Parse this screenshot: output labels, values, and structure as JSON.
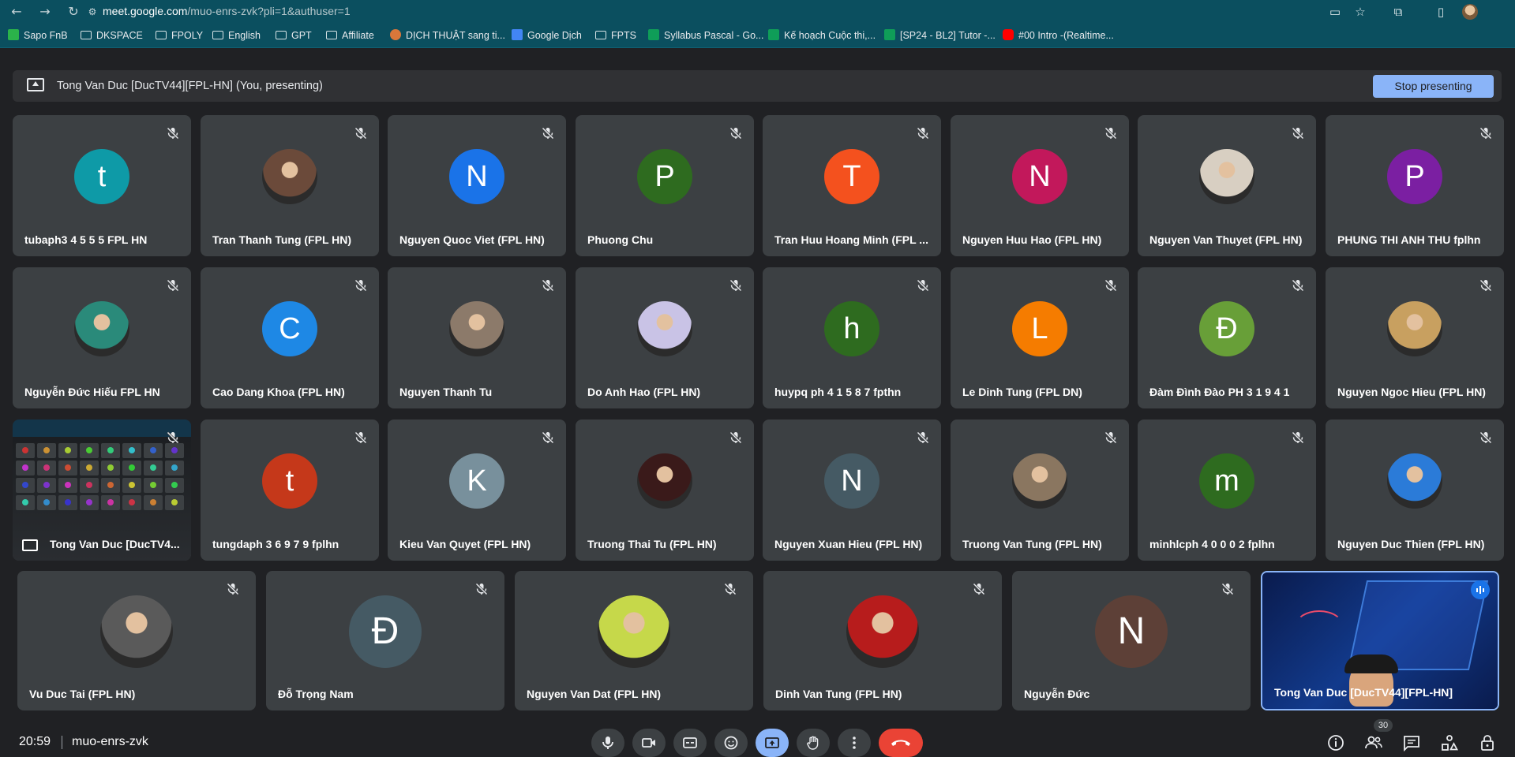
{
  "browser": {
    "url_host": "meet.google.com",
    "url_path": "/muo-enrs-zvk?pli=1&authuser=1",
    "bookmarks": [
      {
        "label": "Sapo FnB",
        "icon": "sapo-icon"
      },
      {
        "label": "DKSPACE",
        "icon": "folder-icon"
      },
      {
        "label": "FPOLY",
        "icon": "folder-icon"
      },
      {
        "label": "English",
        "icon": "folder-icon"
      },
      {
        "label": "GPT",
        "icon": "folder-icon"
      },
      {
        "label": "Affiliate",
        "icon": "folder-icon"
      },
      {
        "label": "DỊCH THUẬT sang ti...",
        "icon": "translate-site-icon"
      },
      {
        "label": "Google Dịch",
        "icon": "google-translate-icon"
      },
      {
        "label": "FPTS",
        "icon": "folder-icon"
      },
      {
        "label": "Syllabus Pascal - Go...",
        "icon": "google-sheets-icon"
      },
      {
        "label": "Kế hoạch Cuộc thi,...",
        "icon": "google-sheets-icon"
      },
      {
        "label": "[SP24 - BL2] Tutor -...",
        "icon": "google-sheets-icon"
      },
      {
        "label": "#00 Intro -(Realtime...",
        "icon": "youtube-icon"
      }
    ]
  },
  "presenting_bar": {
    "text": "Tong Van Duc [DucTV44][FPL-HN] (You, presenting)",
    "stop_label": "Stop presenting"
  },
  "participants": [
    {
      "name": "tubaph3 4 5 5 5 FPL HN",
      "letter": "t",
      "color": "#0e9aa7"
    },
    {
      "name": "Tran Thanh Tung (FPL HN)",
      "letter": "",
      "color": "#6b4a3a"
    },
    {
      "name": "Nguyen Quoc Viet (FPL HN)",
      "letter": "N",
      "color": "#1a73e8"
    },
    {
      "name": "Phuong Chu",
      "letter": "P",
      "color": "#2e6b1f"
    },
    {
      "name": "Tran Huu Hoang Minh (FPL ...",
      "letter": "T",
      "color": "#f4511e"
    },
    {
      "name": "Nguyen Huu Hao (FPL HN)",
      "letter": "N",
      "color": "#c2185b"
    },
    {
      "name": "Nguyen Van Thuyet (FPL HN)",
      "letter": "",
      "color": "#d8cfc2"
    },
    {
      "name": "PHUNG THI ANH THU fplhn",
      "letter": "P",
      "color": "#7b1fa2"
    },
    {
      "name": "Nguyễn Đức Hiếu FPL HN",
      "letter": "",
      "color": "#2a8a7a"
    },
    {
      "name": "Cao Dang Khoa (FPL HN)",
      "letter": "C",
      "color": "#1e88e5"
    },
    {
      "name": "Nguyen Thanh Tu",
      "letter": "",
      "color": "#8c7a6a"
    },
    {
      "name": "Do Anh Hao (FPL HN)",
      "letter": "",
      "color": "#c9c3e6"
    },
    {
      "name": "huypq ph 4 1 5 8 7 fpthn",
      "letter": "h",
      "color": "#2e6b1f"
    },
    {
      "name": "Le Dinh Tung (FPL DN)",
      "letter": "L",
      "color": "#f57c00"
    },
    {
      "name": "Đàm Đình Đào PH 3 1 9 4 1",
      "letter": "Đ",
      "color": "#689f38"
    },
    {
      "name": "Nguyen Ngoc Hieu (FPL HN)",
      "letter": "",
      "color": "#c8a060"
    },
    {
      "name": "Tong Van Duc [DucTV4...",
      "letter": "",
      "color": "#202124"
    },
    {
      "name": "tungdaph 3 6 9 7 9 fplhn",
      "letter": "t",
      "color": "#c5381a"
    },
    {
      "name": "Kieu Van Quyet (FPL HN)",
      "letter": "K",
      "color": "#78909c"
    },
    {
      "name": "Truong Thai Tu (FPL HN)",
      "letter": "",
      "color": "#3a1a1a"
    },
    {
      "name": "Nguyen Xuan Hieu (FPL HN)",
      "letter": "N",
      "color": "#455a64"
    },
    {
      "name": "Truong Van Tung (FPL HN)",
      "letter": "",
      "color": "#8a7660"
    },
    {
      "name": "minhlcph 4 0 0 0 2 fplhn",
      "letter": "m",
      "color": "#2e6b1f"
    },
    {
      "name": "Nguyen Duc Thien (FPL HN)",
      "letter": "",
      "color": "#2b7bd8"
    },
    {
      "name": "Vu Duc Tai (FPL HN)",
      "letter": "",
      "color": "#5a5a5a"
    },
    {
      "name": "Đỗ Trọng Nam",
      "letter": "Đ",
      "color": "#455a64"
    },
    {
      "name": "Nguyen Van Dat (FPL HN)",
      "letter": "",
      "color": "#c6d84a"
    },
    {
      "name": "Dinh Van Tung (FPL HN)",
      "letter": "",
      "color": "#b71c1c"
    },
    {
      "name": "Nguyễn Đức",
      "letter": "N",
      "color": "#5d4037"
    },
    {
      "name": "Tong Van Duc [DucTV44][FPL-HN]",
      "letter": "",
      "color": "#0d2a6b"
    }
  ],
  "bottom": {
    "time": "20:59",
    "meeting_code": "muo-enrs-zvk",
    "people_count": "30"
  },
  "colors": {
    "accent": "#8ab4f8",
    "end_call": "#ea4335",
    "tile_bg": "#3c4043",
    "page_bg": "#202124"
  }
}
